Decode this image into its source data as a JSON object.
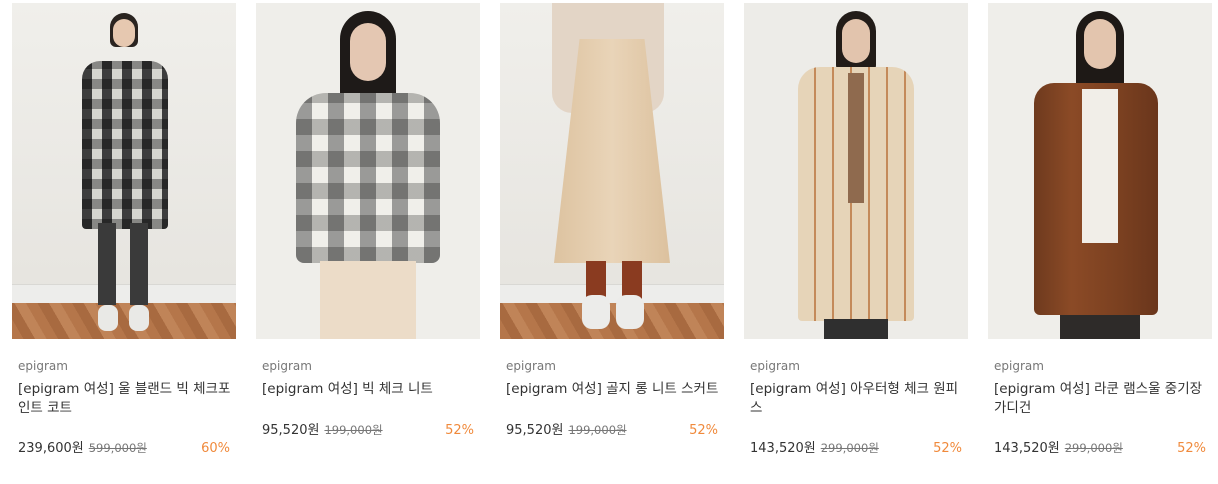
{
  "products": [
    {
      "brand": "epigram",
      "title": "[epigram 여성] 울 블랜드 빅 체크포인트 코트",
      "price": "239,600원",
      "original_price": "599,000원",
      "discount": "60%"
    },
    {
      "brand": "epigram",
      "title": "[epigram 여성] 빅 체크 니트",
      "price": "95,520원",
      "original_price": "199,000원",
      "discount": "52%"
    },
    {
      "brand": "epigram",
      "title": "[epigram 여성] 골지 롱 니트 스커트",
      "price": "95,520원",
      "original_price": "199,000원",
      "discount": "52%"
    },
    {
      "brand": "epigram",
      "title": "[epigram 여성] 아우터형 체크 원피스",
      "price": "143,520원",
      "original_price": "299,000원",
      "discount": "52%"
    },
    {
      "brand": "epigram",
      "title": "[epigram 여성] 라쿤 램스울 중기장 가디건",
      "price": "143,520원",
      "original_price": "299,000원",
      "discount": "52%"
    }
  ],
  "colors": {
    "discount": "#f08a3c",
    "text": "#333333",
    "muted": "#777777"
  }
}
